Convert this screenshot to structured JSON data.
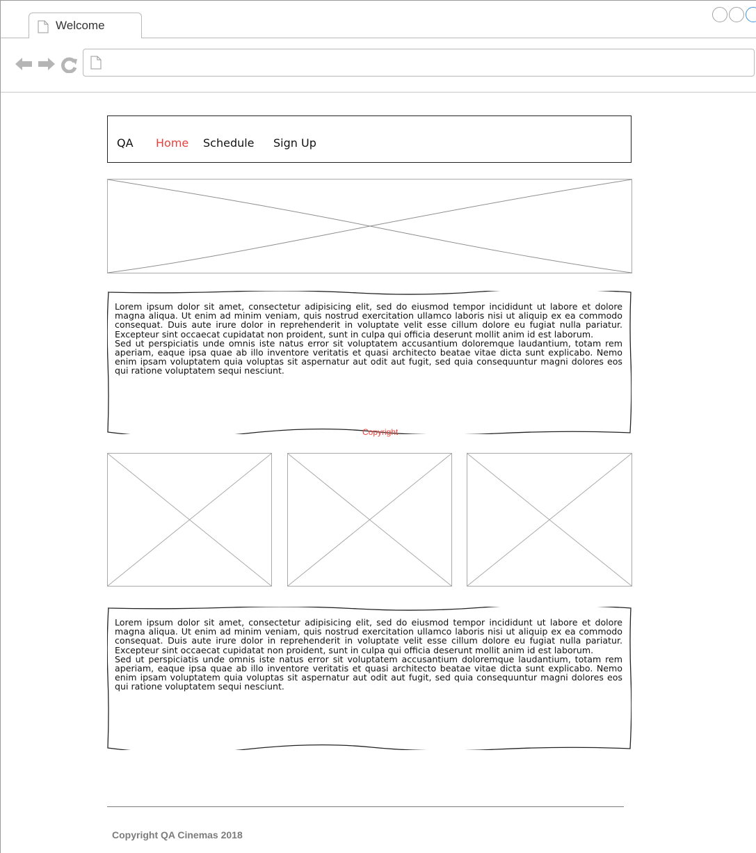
{
  "browser": {
    "tab_title": "Welcome",
    "url": ""
  },
  "nav": {
    "brand": "QA",
    "links": [
      "Home",
      "Schedule",
      "Sign Up"
    ],
    "active_color": "#e8413c"
  },
  "content": {
    "paragraph_1": "Lorem ipsum dolor sit amet, consectetur adipisicing elit, sed do eiusmod tempor incididunt ut labore et dolore magna aliqua. Ut enim ad minim veniam, quis nostrud exercitation ullamco laboris nisi ut aliquip ex ea commodo consequat. Duis aute irure dolor in reprehenderit in voluptate velit esse cillum dolore eu fugiat nulla pariatur. Excepteur sint occaecat cupidatat non proident, sunt in culpa qui officia deserunt mollit anim id est laborum.",
    "paragraph_2": "Sed ut perspiciatis unde omnis iste natus error sit voluptatem accusantium doloremque laudantium, totam rem aperiam, eaque ipsa quae ab illo inventore veritatis et quasi architecto beatae vitae dicta sunt explicabo. Nemo enim ipsam voluptatem quia voluptas sit aspernatur aut odit aut fugit, sed quia consequuntur magni dolores eos qui ratione voluptatem sequi nesciunt.",
    "inline_copyright": "Copyright"
  },
  "footer": {
    "text": "Copyright QA Cinemas 2018"
  }
}
